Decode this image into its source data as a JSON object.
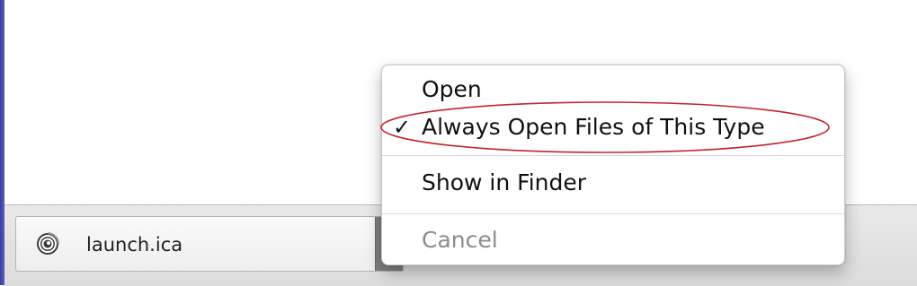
{
  "download_shelf": {
    "item": {
      "file_name": "launch.ica",
      "icon": "citrix-receiver-icon"
    },
    "dropdown_icon": "dropdown-arrow-icon"
  },
  "context_menu": {
    "items": [
      {
        "label": "Open",
        "checked": false,
        "enabled": true
      },
      {
        "label": "Always Open Files of This Type",
        "checked": true,
        "enabled": true
      },
      {
        "label": "Show in Finder",
        "checked": false,
        "enabled": true
      },
      {
        "label": "Cancel",
        "checked": false,
        "enabled": false
      }
    ],
    "check_glyph": "✓"
  },
  "annotation": {
    "color": "#c0252b"
  }
}
